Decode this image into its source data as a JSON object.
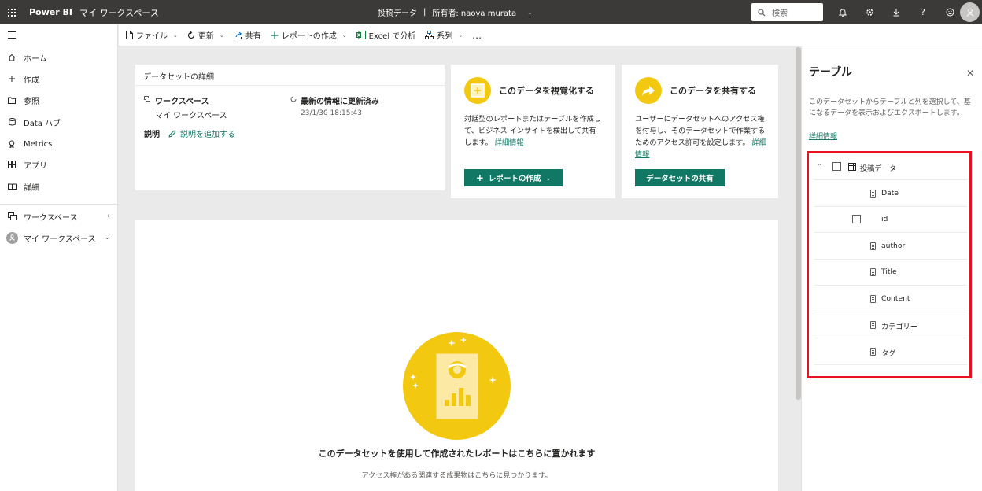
{
  "topbar": {
    "app_name": "Power BI",
    "workspace": "マイ ワークスペース",
    "dataset_title": "投稿データ",
    "separator": "|",
    "owner": "所有者: naoya murata",
    "search_placeholder": "検索"
  },
  "leftnav": {
    "items": [
      {
        "label": "ホーム",
        "icon": "home-icon"
      },
      {
        "label": "作成",
        "icon": "plus-icon"
      },
      {
        "label": "参照",
        "icon": "folder-icon"
      },
      {
        "label": "Data ハブ",
        "icon": "database-icon"
      },
      {
        "label": "Metrics",
        "icon": "trophy-icon"
      },
      {
        "label": "アプリ",
        "icon": "apps-icon"
      },
      {
        "label": "詳細",
        "icon": "book-icon"
      }
    ],
    "workspaces_label": "ワークスペース",
    "my_workspace_label": "マイ ワークスペース"
  },
  "commandbar": {
    "file": "ファイル",
    "refresh": "更新",
    "share": "共有",
    "create_report": "レポートの作成",
    "analyze_excel": "Excel で分析",
    "lineage": "系列",
    "more": "…"
  },
  "details_card": {
    "title": "データセットの詳細",
    "workspace_label": "ワークスペース",
    "workspace_value": "マイ ワークスペース",
    "refresh_label": "最新の情報に更新済み",
    "refresh_value": "23/1/30 18:15:43",
    "description_label": "説明",
    "add_description": "説明を追加する"
  },
  "visualize_card": {
    "title": "このデータを視覚化する",
    "body": "対話型のレポートまたはテーブルを作成して、ビジネス インサイトを検出して共有します。",
    "link": "詳細情報",
    "button": "レポートの作成"
  },
  "share_card": {
    "title": "このデータを共有する",
    "body": "ユーザーにデータセットへのアクセス権を付与し、そのデータセットで作業するためのアクセス許可を設定します。",
    "link": "詳細情報",
    "button": "データセットの共有"
  },
  "empty_state": {
    "title": "このデータセットを使用して作成されたレポートはこちらに置かれます",
    "subtitle": "アクセス権がある関連する成果物はこちらに見つかります。"
  },
  "tables_pane": {
    "title": "テーブル",
    "description": "このデータセットからテーブルと列を選択して、基になるデータを表示およびエクスポートします。",
    "link": "詳細情報",
    "table_name": "投稿データ",
    "fields": [
      "Date",
      "id",
      "author",
      "Title",
      "Content",
      "カテゴリー",
      "タグ"
    ]
  }
}
